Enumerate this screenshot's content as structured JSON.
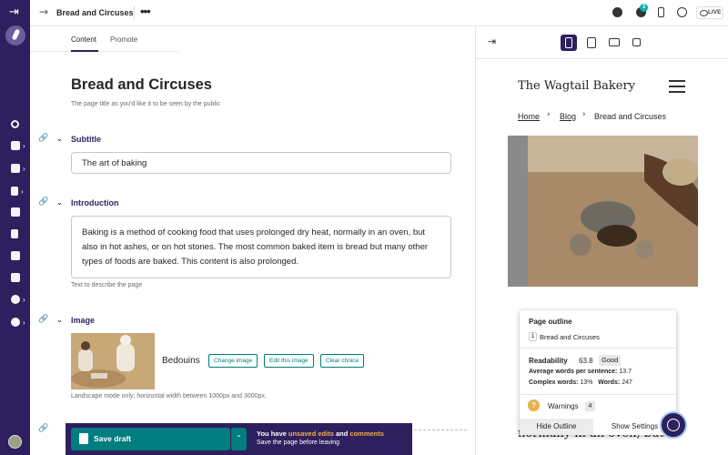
{
  "topbar": {
    "back_icon": "→",
    "title": "Bread and Circuses",
    "more_label": "•••",
    "comment_count": "3",
    "live_label": "LIVE"
  },
  "tabs": [
    {
      "label": "Content",
      "active": true
    },
    {
      "label": "Promote",
      "active": false
    }
  ],
  "editor": {
    "page_title": "Bread and Circuses",
    "page_title_help": "The page title as you'd like it to be seen by the public",
    "subtitle": {
      "label": "Subtitle",
      "value": "The art of baking"
    },
    "introduction": {
      "label": "Introduction",
      "value": "Baking is a method of cooking food that uses prolonged dry heat, normally in an oven, but also in hot ashes, or on hot stones. The most common baked item is bread but many other types of foods are baked. This content is also prolonged.",
      "help": "Text to describe the page"
    },
    "image": {
      "label": "Image",
      "name": "Bedouins",
      "buttons": [
        "Change image",
        "Edit this image",
        "Clear choice"
      ],
      "help": "Landscape mode only; horizontal width between 1000px and 3000px."
    }
  },
  "savebar": {
    "save_label": "Save draft",
    "message_prefix": "You have ",
    "message_edits": "unsaved edits",
    "message_and": " and ",
    "message_comments": "comments",
    "message_sub": "Save the page before leaving"
  },
  "preview": {
    "site_name": "The Wagtail Bakery",
    "breadcrumbs": [
      "Home",
      "Blog",
      "Bread and Circuses"
    ],
    "body_text": "normally in an oven, but"
  },
  "outline": {
    "title": "Page outline",
    "heading_level": "1",
    "heading_text": "Bread and Circuses",
    "readability_label": "Readability",
    "readability_score": "63.8",
    "readability_rating": "Good",
    "avg_words_label": "Average words per sentence:",
    "avg_words_value": "13.7",
    "complex_label": "Complex words:",
    "complex_value": "13%",
    "words_label": "Words:",
    "words_value": "247",
    "warnings_label": "Warnings",
    "warnings_count": "4",
    "hide_label": "Hide Outline",
    "settings_label": "Show Settings"
  },
  "colors": {
    "sidebar": "#2e1f5e",
    "primary_button": "#007d7e",
    "highlight": "#f5b04b"
  }
}
